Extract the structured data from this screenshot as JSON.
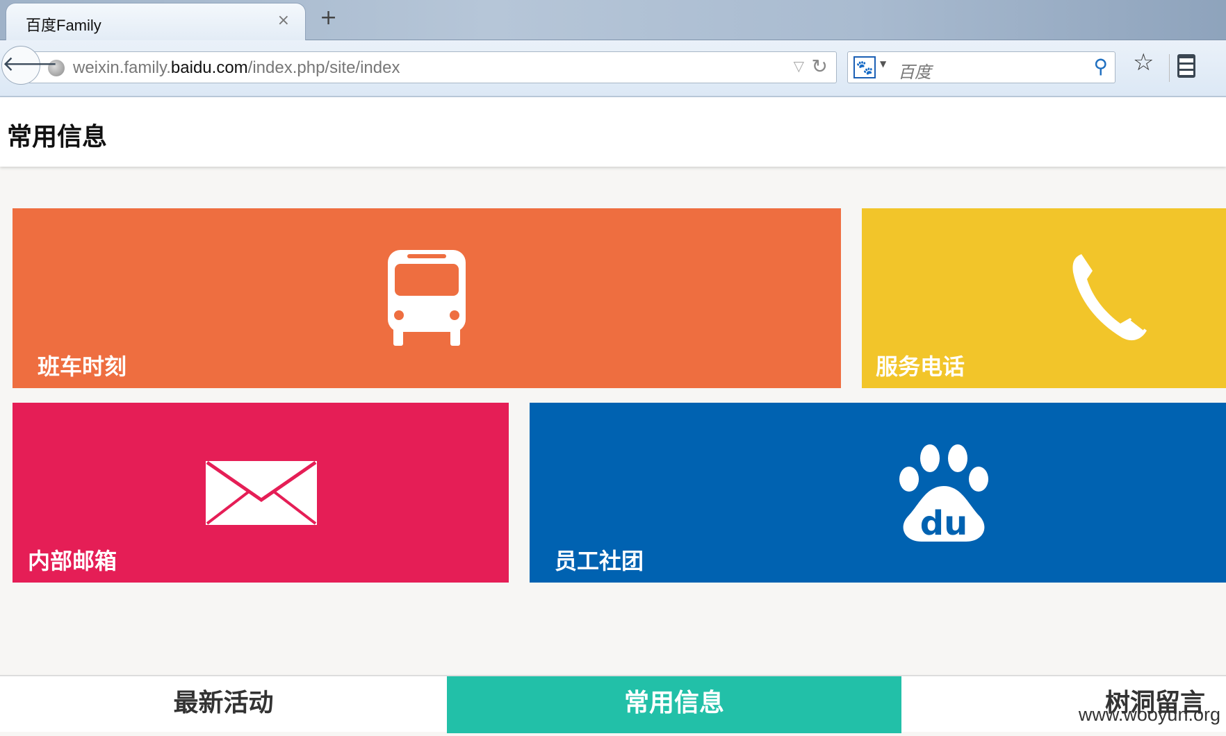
{
  "browser": {
    "tab_title": "百度Family",
    "tab_close": "×",
    "new_tab": "+",
    "back": "🡐",
    "url_host_prefix": "weixin.family.",
    "url_host_main": "baidu.com",
    "url_path": "/index.php/site/index",
    "search_engine_icon": "baidu-paw-icon",
    "search_placeholder": "百度"
  },
  "header": {
    "title": "常用信息"
  },
  "tiles": [
    {
      "label": "班车时刻",
      "icon": "bus-icon",
      "color": "#ee6e40"
    },
    {
      "label": "服务电话",
      "icon": "phone-icon",
      "color": "#f2c52a"
    },
    {
      "label": "内部邮箱",
      "icon": "mail-icon",
      "color": "#e51e56"
    },
    {
      "label": "员工社团",
      "icon": "baidu-paw-icon",
      "color": "#0062b1"
    }
  ],
  "bottom_nav": [
    {
      "label": "最新活动",
      "active": false
    },
    {
      "label": "常用信息",
      "active": true
    },
    {
      "label": "树洞留言",
      "active": false
    }
  ],
  "watermark": "www.wooyun.org",
  "colors": {
    "accent": "#22c0a8",
    "background": "#f7f6f4"
  }
}
